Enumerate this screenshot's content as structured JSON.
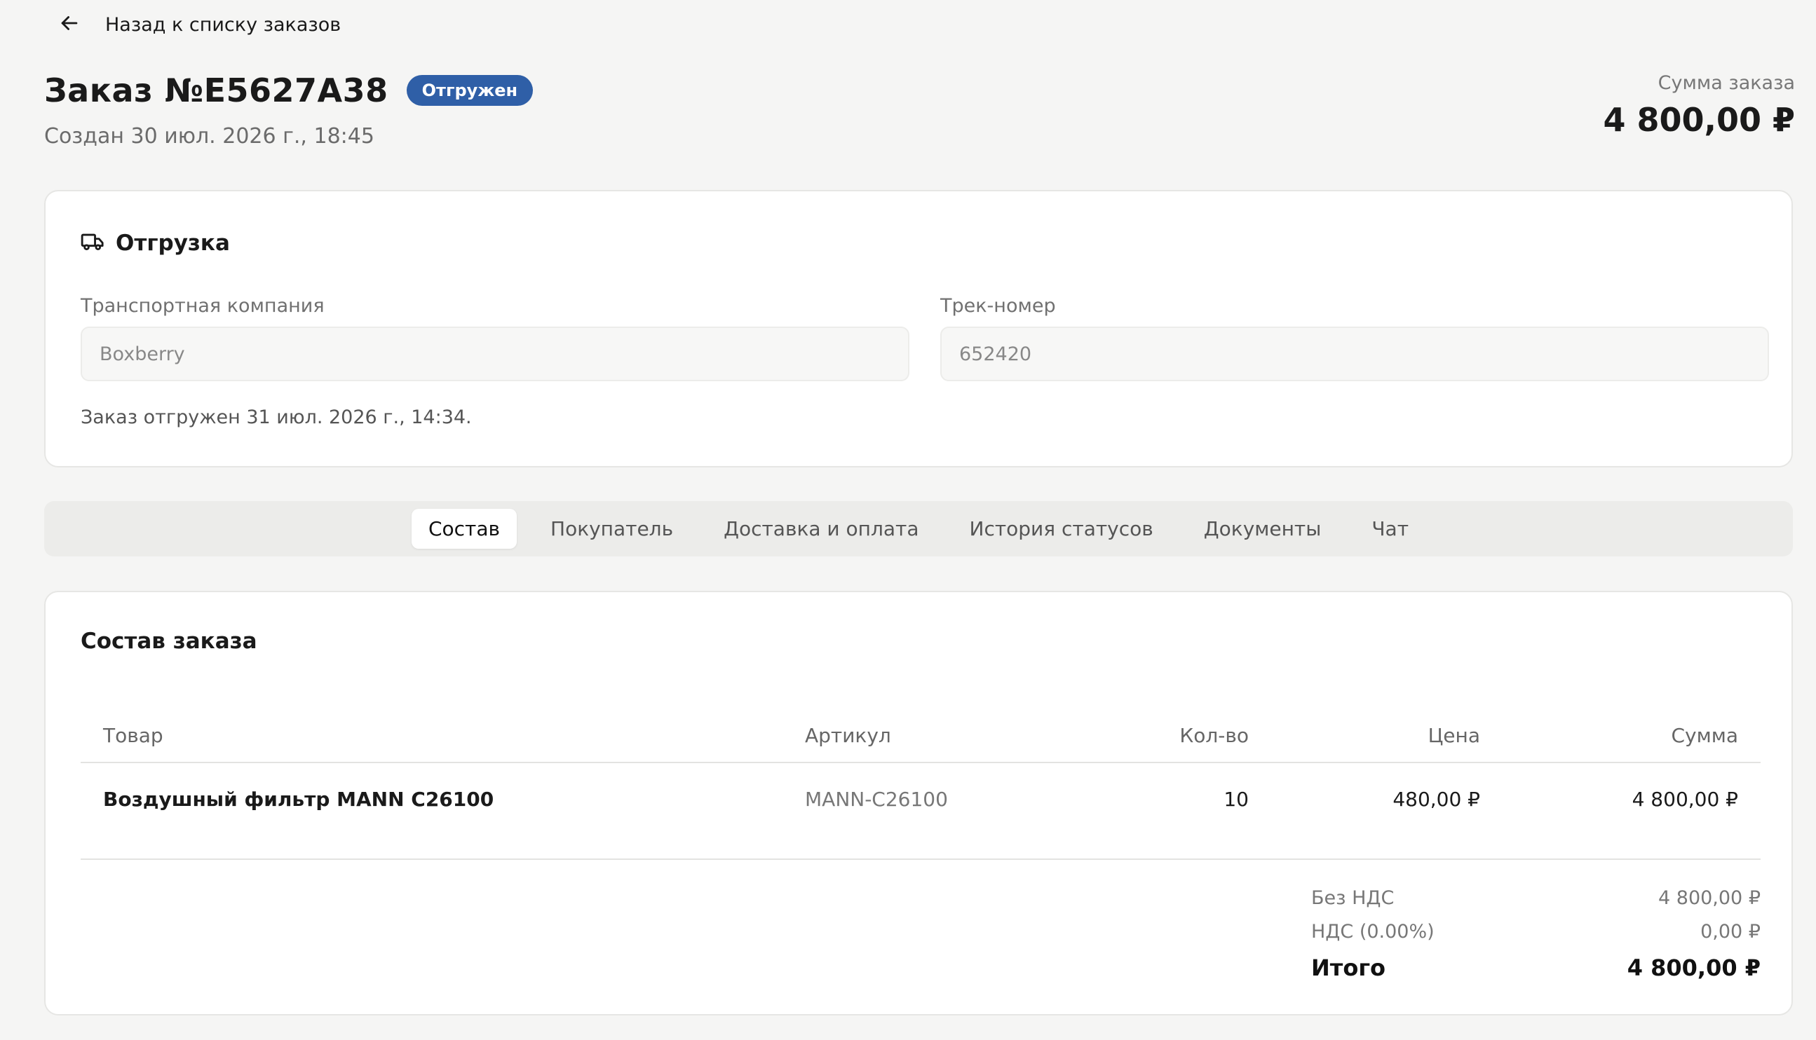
{
  "nav": {
    "back_label": "Назад к списку заказов"
  },
  "order": {
    "title": "Заказ №E5627A38",
    "status": "Отгружен",
    "status_color": "#2f5fa7",
    "created": "Создан 30 июл. 2026 г., 18:45",
    "sum_label": "Сумма заказа",
    "sum_value": "4 800,00 ₽"
  },
  "shipment": {
    "title": "Отгрузка",
    "carrier_label": "Транспортная компания",
    "carrier_value": "Boxberry",
    "track_label": "Трек-номер",
    "track_value": "652420",
    "note": "Заказ отгружен 31 июл. 2026 г., 14:34."
  },
  "tabs": [
    {
      "label": "Состав",
      "active": true
    },
    {
      "label": "Покупатель",
      "active": false
    },
    {
      "label": "Доставка и оплата",
      "active": false
    },
    {
      "label": "История статусов",
      "active": false
    },
    {
      "label": "Документы",
      "active": false
    },
    {
      "label": "Чат",
      "active": false
    }
  ],
  "items": {
    "title": "Состав заказа",
    "columns": {
      "name": "Товар",
      "sku": "Артикул",
      "qty": "Кол-во",
      "price": "Цена",
      "sum": "Сумма"
    },
    "rows": [
      {
        "name": "Воздушный фильтр MANN C26100",
        "sku": "MANN-C26100",
        "qty": "10",
        "price": "480,00 ₽",
        "sum": "4 800,00 ₽"
      }
    ],
    "totals": {
      "no_vat_label": "Без НДС",
      "no_vat_value": "4 800,00 ₽",
      "vat_label": "НДС (0.00%)",
      "vat_value": "0,00 ₽",
      "total_label": "Итого",
      "total_value": "4 800,00 ₽"
    }
  }
}
